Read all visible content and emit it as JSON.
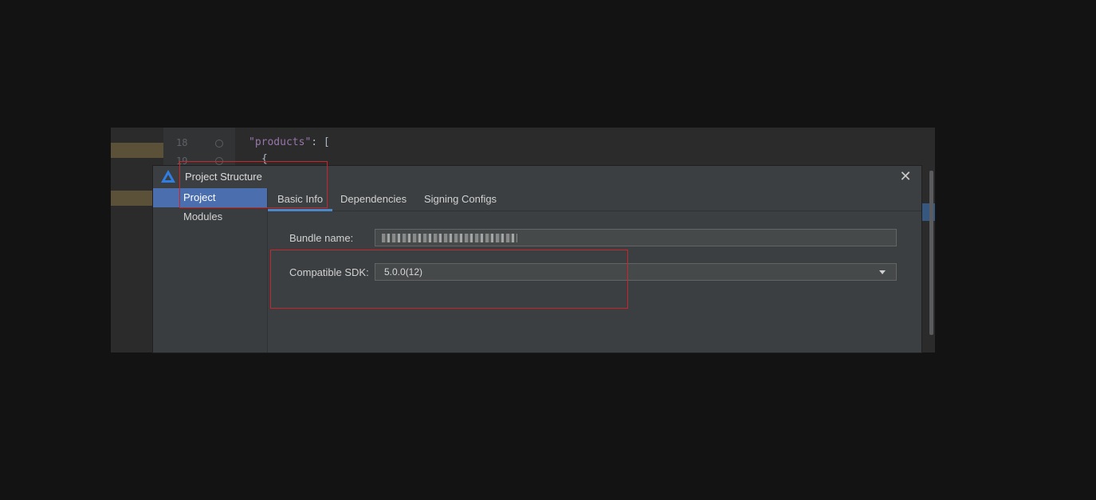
{
  "editor": {
    "line_numbers": [
      "18",
      "19"
    ],
    "code_line_1_key": "\"products\"",
    "code_line_1_rest": ": [",
    "code_line_2": "{"
  },
  "dialog": {
    "title": "Project Structure",
    "close_glyph": "✕",
    "nav": [
      {
        "label": "Project",
        "selected": true
      },
      {
        "label": "Modules",
        "selected": false
      }
    ],
    "tabs": [
      {
        "label": "Basic Info",
        "active": true
      },
      {
        "label": "Dependencies",
        "active": false
      },
      {
        "label": "Signing Configs",
        "active": false
      }
    ],
    "bundle_name_label": "Bundle name:",
    "compatible_sdk_label": "Compatible SDK:",
    "compatible_sdk_value": "5.0.0(12)"
  },
  "colors": {
    "selection": "#4b6eaf",
    "annotation_red": "#c8262a",
    "tab_underline": "#4a88c7"
  },
  "icons": [
    "app-logo-icon",
    "close-icon",
    "dropdown-arrow-icon"
  ]
}
